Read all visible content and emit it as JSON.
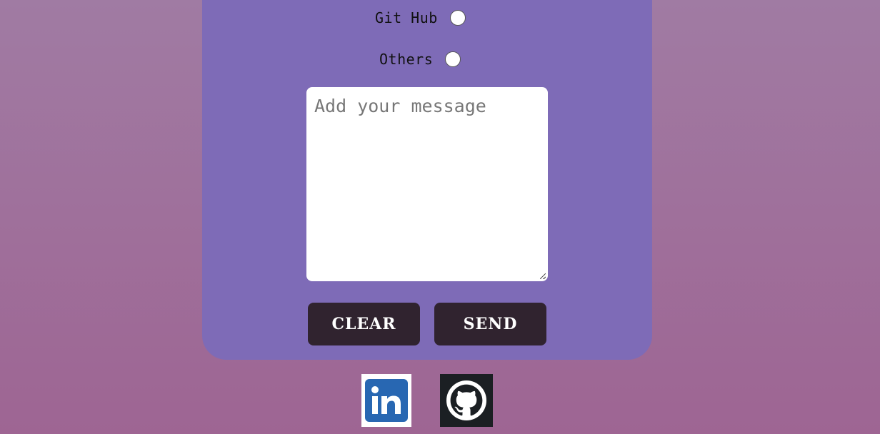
{
  "contact_form": {
    "options": [
      {
        "label": "Git Hub"
      },
      {
        "label": "Others"
      }
    ],
    "message_placeholder": "Add your message",
    "buttons": {
      "clear_label": "CLEAR",
      "send_label": "SEND"
    }
  },
  "social_links": [
    {
      "name": "LinkedIn",
      "icon": "linkedin-icon"
    },
    {
      "name": "GitHub",
      "icon": "github-icon"
    }
  ],
  "colors": {
    "page_gradient_top": "#a07ba3",
    "page_gradient_bottom": "#9e6593",
    "card_background": "#7e6bb7",
    "button_background": "#30232f",
    "linkedin_blue": "#2867b2",
    "github_dark": "#1b1f23"
  }
}
